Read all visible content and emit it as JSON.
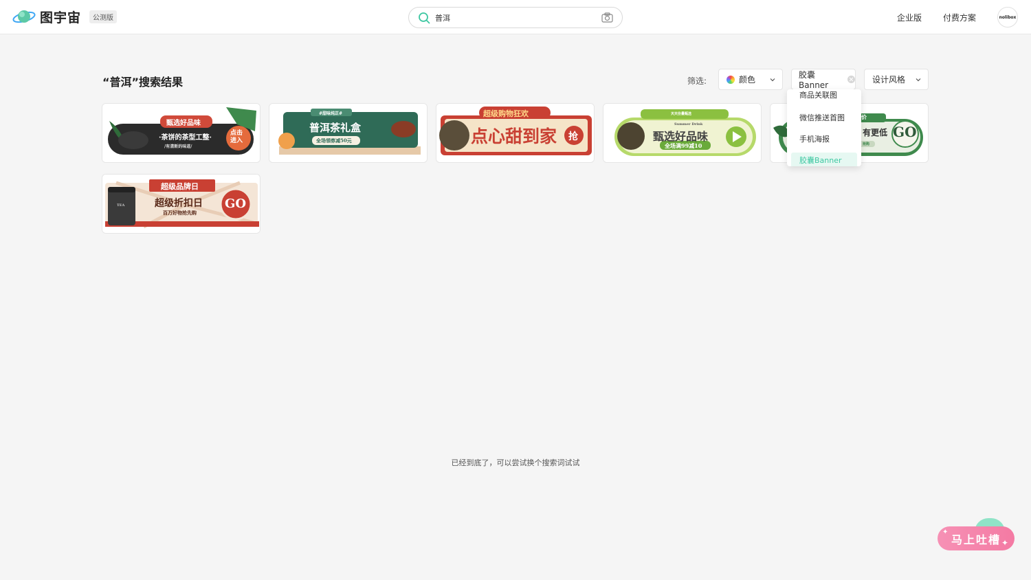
{
  "header": {
    "logo_text": "图宇宙",
    "beta_badge": "公测版",
    "search_value": "普洱",
    "nav_enterprise": "企业版",
    "nav_pricing": "付费方案",
    "avatar_text": "nolibox"
  },
  "results": {
    "title": "“普洱”搜索结果",
    "filter_label": "筛选:",
    "filter_color": "颜色",
    "filter_type": "胶囊Banner",
    "filter_style": "设计风格"
  },
  "dropdown": {
    "items": [
      "商品关联图",
      "微信推送首图",
      "手机海报",
      "胶囊Banner"
    ],
    "selected": "胶囊Banner"
  },
  "cards": [
    {
      "tag": "甄选好品味",
      "main": "·茶饼的茶型工整·",
      "sub": "/有清新的味道/",
      "cta": "点击进入"
    },
    {
      "tag": "#甜味纯正#",
      "main": "普洱茶礼盒",
      "sub": "全场领劵减50元"
    },
    {
      "tag": "超级购物狂欢",
      "main": "点心甜到家",
      "cta": "抢"
    },
    {
      "tag": "天天份量甄选",
      "eng": "Summer Drink",
      "main": "甄选好品味",
      "sub": "全场满99减10"
    },
    {
      "tag": "价",
      "main": "有更低",
      "cta": "GO",
      "sub": "抢购"
    },
    {
      "tag": "超级品牌日",
      "main": "超级折扣日",
      "sub": "百万好物抢先购",
      "cta": "GO",
      "can": "TEA"
    }
  ],
  "footer": {
    "end_text": "已经到底了，可以尝试换个搜索词试试",
    "feedback": "马上吐槽"
  },
  "colors": {
    "accent": "#3cc7a1",
    "feedback_pink": "#f47aa3"
  }
}
